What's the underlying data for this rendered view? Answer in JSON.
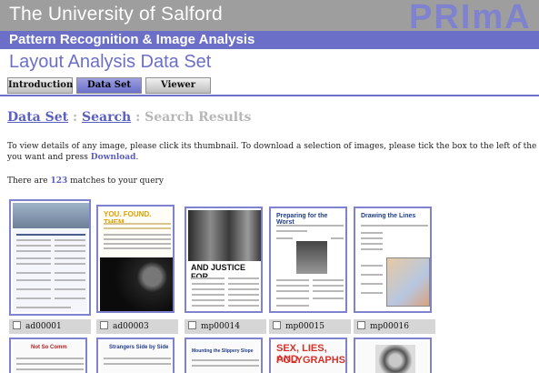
{
  "header": {
    "university": "The University of Salford",
    "logo": "PRImA",
    "subtitle": "Pattern Recognition & Image Analysis",
    "dataset_title": "Layout Analysis Data Set"
  },
  "tabs": [
    {
      "label": "Introduction",
      "active": false
    },
    {
      "label": "Data Set",
      "active": true
    },
    {
      "label": "Viewer",
      "active": false
    }
  ],
  "breadcrumb": {
    "link1": "Data Set",
    "sep1": " : ",
    "link2": "Search",
    "sep2": " : ",
    "current": "Search Results"
  },
  "instructions": {
    "line1": "To view details of any image, please click its thumbnail. To download a selection of images, please tick the box to the left of the image(s",
    "line2_prefix": "you want and press ",
    "download_link": "Download",
    "line2_suffix": "."
  },
  "matches": {
    "prefix": "There are ",
    "count": "123",
    "suffix": " matches to your query"
  },
  "results": [
    {
      "id": "ad00001"
    },
    {
      "id": "ad00003"
    },
    {
      "id": "mp00014"
    },
    {
      "id": "mp00015"
    },
    {
      "id": "mp00016"
    }
  ],
  "thumb_text": {
    "ad00003_headline": "YOU. FOUND. THEM.",
    "mp00014_headline": "AND JUSTICE FOR...",
    "mp00015_headline": "Preparing for the Worst",
    "mp00016_headline": "Drawing the Lines",
    "row2_a": "Not So Comm",
    "row2_b": "Strangers Side by Side",
    "row2_c": "Mounting the Slippery Slope",
    "row2_d_1": "SEX, LIES, AND",
    "row2_d_2": "POLYGRAPHS"
  },
  "colors": {
    "brand": "#6b6fc8",
    "logo": "#7f82ce",
    "header_gray": "#9e9e9e",
    "orange_title": "#e0a000",
    "red_title": "#d4332b"
  }
}
